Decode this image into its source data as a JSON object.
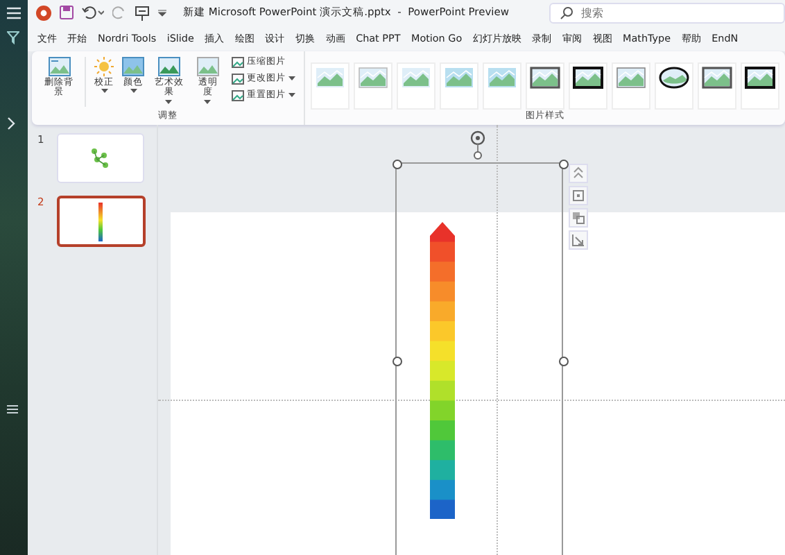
{
  "title_bar": {
    "title": "新建 Microsoft PowerPoint 演示文稿.pptx  -  PowerPoint Preview",
    "search": {
      "placeholder": "搜索"
    }
  },
  "tabs": [
    {
      "label": "文件"
    },
    {
      "label": "开始"
    },
    {
      "label": "Nordri Tools"
    },
    {
      "label": "iSlide"
    },
    {
      "label": "插入"
    },
    {
      "label": "绘图"
    },
    {
      "label": "设计"
    },
    {
      "label": "切换"
    },
    {
      "label": "动画"
    },
    {
      "label": "Chat PPT"
    },
    {
      "label": "Motion Go"
    },
    {
      "label": "幻灯片放映"
    },
    {
      "label": "录制"
    },
    {
      "label": "审阅"
    },
    {
      "label": "视图"
    },
    {
      "label": "MathType"
    },
    {
      "label": "帮助"
    },
    {
      "label": "EndN"
    }
  ],
  "ribbon": {
    "adjust": {
      "label": "调整",
      "large_buttons": [
        {
          "label": "删除背景",
          "kind": "remove-bg",
          "dropdown": false
        },
        {
          "label": "校正",
          "kind": "sun",
          "dropdown": true
        },
        {
          "label": "颜色",
          "kind": "color",
          "dropdown": true
        },
        {
          "label": "艺术效果",
          "kind": "art",
          "dropdown": true
        },
        {
          "label": "透明度",
          "kind": "transparency",
          "dropdown": true
        }
      ],
      "small_buttons": [
        {
          "label": "压缩图片",
          "dropdown": false
        },
        {
          "label": "更改图片",
          "dropdown": true
        },
        {
          "label": "重置图片",
          "dropdown": true
        }
      ]
    },
    "picture_styles": {
      "label": "图片样式",
      "styles": [
        {
          "kind": "plain"
        },
        {
          "kind": "shadow"
        },
        {
          "kind": "soft"
        },
        {
          "kind": "reflect"
        },
        {
          "kind": "reflect"
        },
        {
          "kind": "dark-frame"
        },
        {
          "kind": "black-frame"
        },
        {
          "kind": "border"
        },
        {
          "kind": "oval"
        },
        {
          "kind": "dark-frame"
        },
        {
          "kind": "black-frame"
        }
      ]
    }
  },
  "slides": [
    {
      "number": "1",
      "selected": false,
      "kind": "clover"
    },
    {
      "number": "2",
      "selected": true,
      "kind": "gradient-bar"
    }
  ]
}
